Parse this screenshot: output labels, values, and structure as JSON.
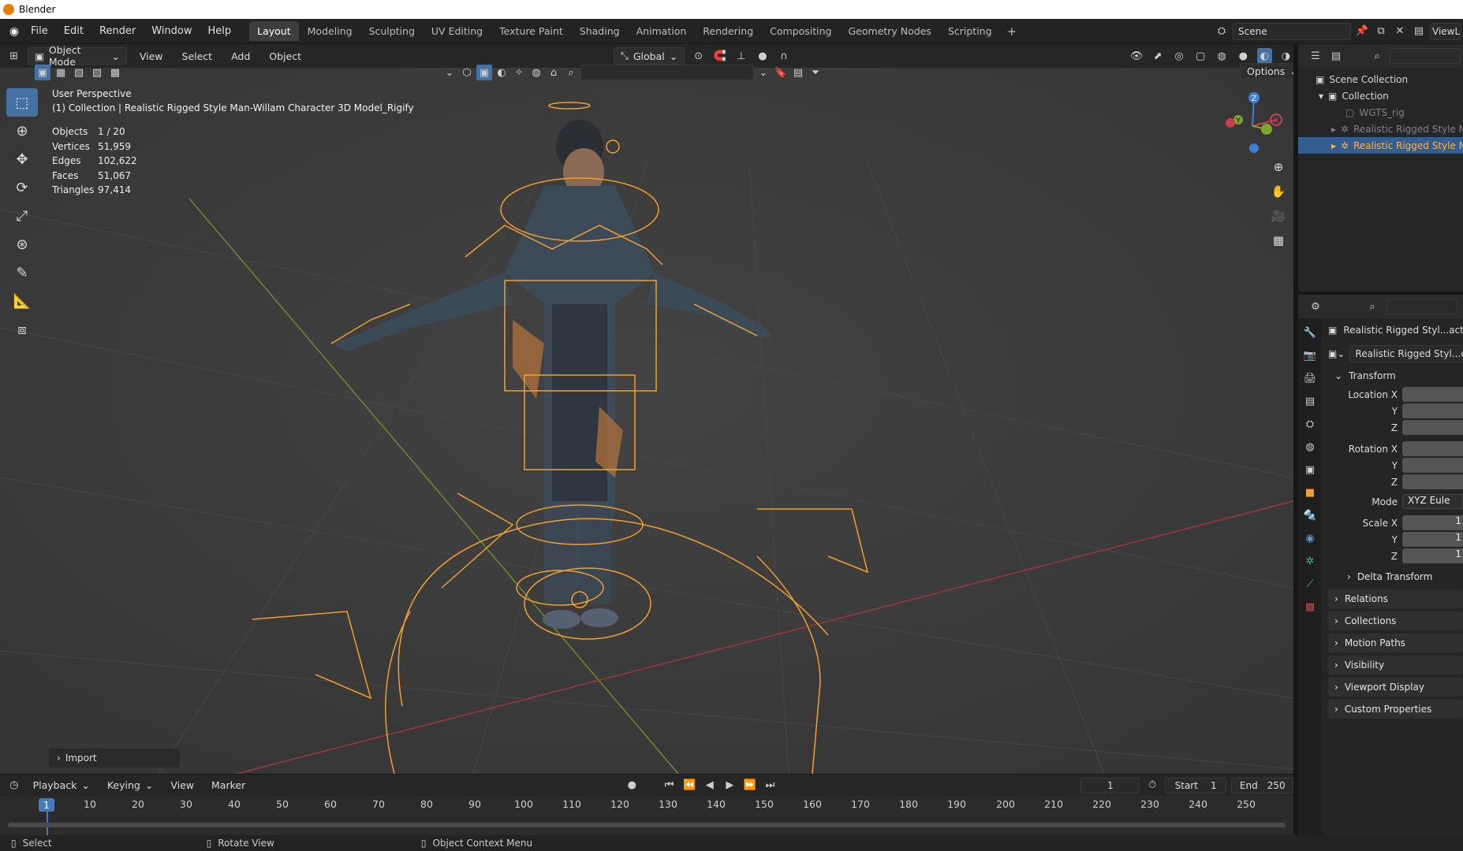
{
  "window": {
    "title": "Blender"
  },
  "menu": [
    "File",
    "Edit",
    "Render",
    "Window",
    "Help"
  ],
  "workspaces": {
    "tabs": [
      "Layout",
      "Modeling",
      "Sculpting",
      "UV Editing",
      "Texture Paint",
      "Shading",
      "Animation",
      "Rendering",
      "Compositing",
      "Geometry Nodes",
      "Scripting"
    ],
    "active": "Layout",
    "add": "+"
  },
  "scene": {
    "name": "Scene",
    "view_layer": "ViewL"
  },
  "viewport_header": {
    "mode": "Object Mode",
    "menus": [
      "View",
      "Select",
      "Add",
      "Object"
    ],
    "orientation": "Global",
    "options": "Options"
  },
  "viewport": {
    "perspective": "User Perspective",
    "collection_line": "(1) Collection | Realistic Rigged Style Man-Willam Character 3D Model_Rigify",
    "stats": [
      {
        "label": "Objects",
        "value": "1 / 20"
      },
      {
        "label": "Vertices",
        "value": "51,959"
      },
      {
        "label": "Edges",
        "value": "102,622"
      },
      {
        "label": "Faces",
        "value": "51,067"
      },
      {
        "label": "Triangles",
        "value": "97,414"
      }
    ],
    "gizmo": {
      "z": "Z",
      "y": "Y",
      "x": "X"
    },
    "import_panel": "Import"
  },
  "outliner": {
    "root": "Scene Collection",
    "collection": "Collection",
    "items": [
      "WGTS_rig",
      "Realistic Rigged Style M",
      "Realistic Rigged Style M"
    ]
  },
  "properties": {
    "object_name": "Realistic Rigged Styl...acter",
    "data_name": "Realistic Rigged Styl...cte",
    "transform_label": "Transform",
    "location": [
      "Location X",
      "Y",
      "Z"
    ],
    "rotation": [
      "Rotation X",
      "Y",
      "Z"
    ],
    "mode_label": "Mode",
    "mode_value": "XYZ Eule",
    "scale": [
      "Scale X",
      "Y",
      "Z"
    ],
    "scale_values": [
      "1",
      "1",
      "1"
    ],
    "sections": [
      "Delta Transform",
      "Relations",
      "Collections",
      "Motion Paths",
      "Visibility",
      "Viewport Display",
      "Custom Properties"
    ]
  },
  "timeline": {
    "menus": [
      "Playback",
      "Keying",
      "View",
      "Marker"
    ],
    "current_frame": "1",
    "start_label": "Start",
    "start": "1",
    "end_label": "End",
    "end": "250",
    "ticks": [
      "1",
      "10",
      "20",
      "30",
      "40",
      "50",
      "60",
      "70",
      "80",
      "90",
      "100",
      "110",
      "120",
      "130",
      "140",
      "150",
      "160",
      "170",
      "180",
      "190",
      "200",
      "210",
      "220",
      "230",
      "240",
      "250"
    ]
  },
  "statusbar": [
    "Select",
    "Rotate View",
    "Object Context Menu"
  ],
  "colors": {
    "accent": "#4672a3",
    "selection": "#f0a030",
    "x_axis": "#c8404a",
    "y_axis": "#7fa62d",
    "z_axis": "#3f7fd9"
  }
}
